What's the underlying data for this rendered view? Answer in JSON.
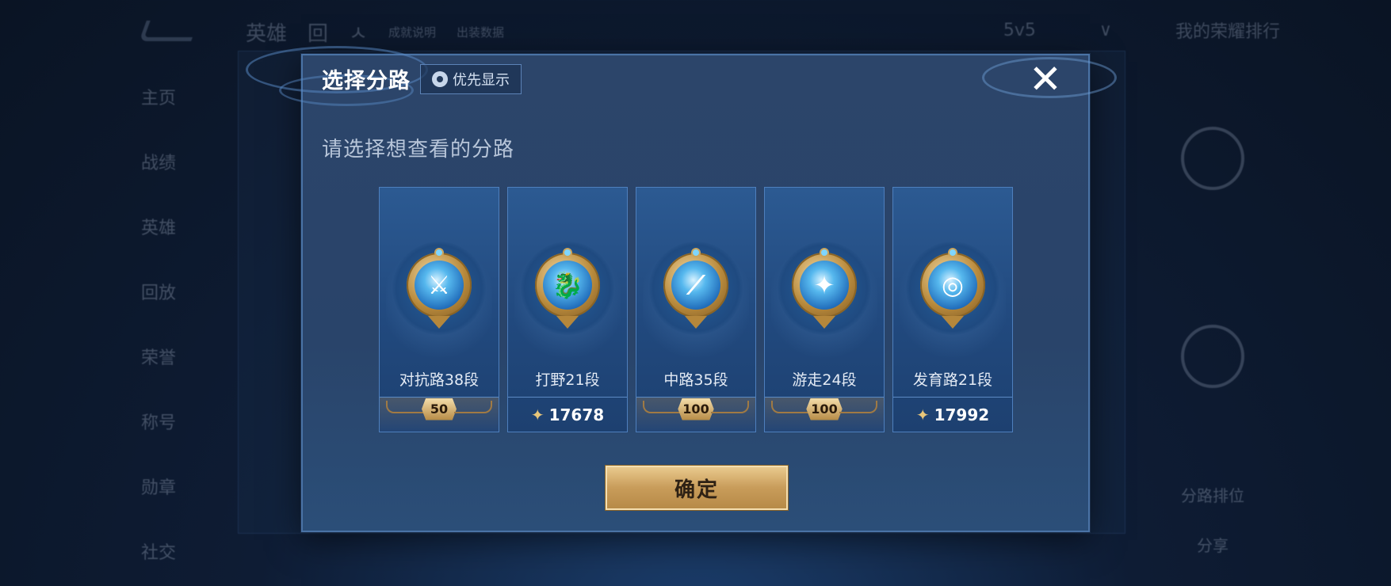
{
  "background": {
    "top_left_items": [
      "英雄",
      "回",
      "ㅅ",
      "成就说明",
      "出装数据"
    ],
    "top_right_items": [
      "5v5",
      "∨",
      "我的荣耀排行"
    ],
    "sidebar_items": [
      "主页",
      "战绩",
      "英雄",
      "回放",
      "荣誉",
      "称号",
      "勋章",
      "社交"
    ],
    "right_labels": [
      "分路排位",
      "分享"
    ]
  },
  "modal": {
    "title": "选择分路",
    "priority_button_label": "优先显示",
    "priority_icon": "gear-icon",
    "close_glyph": "✕",
    "subtitle": "请选择想查看的分路",
    "confirm_label": "确定"
  },
  "lanes": [
    {
      "name": "对抗路38段",
      "icon": "clash-lane-icon",
      "glyph": "⚔",
      "footer_type": "rank",
      "footer_value": "50"
    },
    {
      "name": "打野21段",
      "icon": "jungle-icon",
      "glyph": "🐉",
      "footer_type": "points",
      "footer_value": "17678"
    },
    {
      "name": "中路35段",
      "icon": "mid-lane-icon",
      "glyph": "⟋",
      "footer_type": "rank",
      "footer_value": "100"
    },
    {
      "name": "游走24段",
      "icon": "roam-icon",
      "glyph": "✦",
      "footer_type": "rank",
      "footer_value": "100"
    },
    {
      "name": "发育路21段",
      "icon": "farm-lane-icon",
      "glyph": "◎",
      "footer_type": "points",
      "footer_value": "17992"
    }
  ],
  "colors": {
    "accent_gold": "#c89c5a",
    "panel_blue": "#29446a",
    "lane_blue": "#21497e"
  }
}
